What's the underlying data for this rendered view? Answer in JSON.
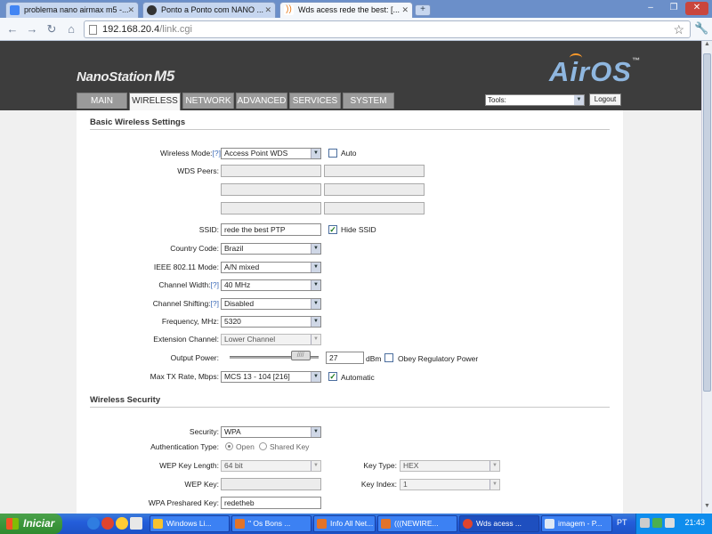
{
  "browser": {
    "tabs": [
      {
        "title": "problema nano airmax m5 -...",
        "active": false
      },
      {
        "title": "Ponto a Ponto com NANO ...",
        "active": false
      },
      {
        "title": "Wds acess rede the best: [...",
        "active": true
      }
    ],
    "url_host": "192.168.20.4",
    "url_path": "/link.cgi"
  },
  "header": {
    "brand": "NanoStation",
    "model": "M5",
    "logo": "AirOS",
    "logo_tm": "™",
    "tabs": [
      "MAIN",
      "WIRELESS",
      "NETWORK",
      "ADVANCED",
      "SERVICES",
      "SYSTEM"
    ],
    "active_tab": "WIRELESS",
    "tools_value": "Tools:",
    "logout_label": "Logout"
  },
  "basic": {
    "title": "Basic Wireless Settings",
    "wireless_mode_label": "Wireless Mode:",
    "help": "[?]",
    "wireless_mode": "Access Point WDS",
    "auto_label": "Auto",
    "wds_peers_label": "WDS Peers:",
    "ssid_label": "SSID:",
    "ssid": "rede the best PTP",
    "hide_ssid_label": "Hide SSID",
    "country_label": "Country Code:",
    "country": "Brazil",
    "ieee_label": "IEEE 802.11 Mode:",
    "ieee": "A/N mixed",
    "channel_width_label": "Channel Width:",
    "channel_width": "40 MHz",
    "channel_shifting_label": "Channel Shifting:",
    "channel_shifting": "Disabled",
    "frequency_label": "Frequency, MHz:",
    "frequency": "5320",
    "extension_label": "Extension Channel:",
    "extension": "Lower Channel",
    "output_power_label": "Output Power:",
    "output_power": "27",
    "output_power_unit": "dBm",
    "output_power_fraction": 0.88,
    "obey_label": "Obey Regulatory Power",
    "max_tx_label": "Max TX Rate, Mbps:",
    "max_tx": "MCS 13 - 104 [216]",
    "automatic_label": "Automatic"
  },
  "security": {
    "title": "Wireless Security",
    "security_label": "Security:",
    "security": "WPA",
    "auth_label": "Authentication Type:",
    "auth_open": "Open",
    "auth_shared": "Shared Key",
    "wep_len_label": "WEP Key Length:",
    "wep_len": "64 bit",
    "key_type_label": "Key Type:",
    "key_type": "HEX",
    "wep_key_label": "WEP Key:",
    "key_index_label": "Key Index:",
    "key_index": "1",
    "wpa_key_label": "WPA Preshared Key:",
    "wpa_key": "redetheb"
  },
  "taskbar": {
    "start_label": "Iniciar",
    "buttons": [
      {
        "label": "Windows Li...",
        "active": false
      },
      {
        "label": "\" Os Bons ...",
        "active": false
      },
      {
        "label": "Info All Net...",
        "active": false
      },
      {
        "label": "(((NEWIRE...",
        "active": false
      },
      {
        "label": "Wds acess ...",
        "active": true
      },
      {
        "label": "imagem - P...",
        "active": false
      }
    ],
    "lang": "PT",
    "clock": "21:43"
  },
  "colors": {
    "header_bg": "#3d3d3d",
    "accent_blue": "#8fb7e0",
    "accent_orange": "#ff9a2a",
    "checkbox_check": "#1e7b1e"
  }
}
